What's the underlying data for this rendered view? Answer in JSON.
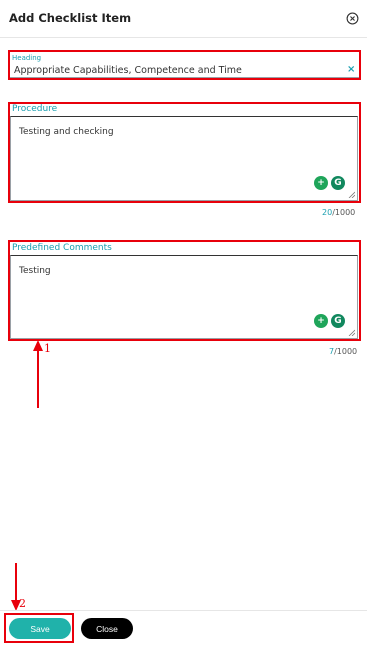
{
  "dialog": {
    "title": "Add Checklist Item"
  },
  "heading": {
    "label": "Heading",
    "value": "Appropriate Capabilities, Competence and Time",
    "clear": "×"
  },
  "procedure": {
    "label": "Procedure",
    "value": "Testing and checking",
    "count": "20",
    "max": "/1000"
  },
  "predefined": {
    "label": "Predefined Comments",
    "value": "Testing",
    "count": "7",
    "max": "/1000"
  },
  "annotations": {
    "one": "1",
    "two": "2"
  },
  "footer": {
    "save_label": "Save",
    "close_label": "Close"
  },
  "colors": {
    "accent": "#1a9fb0",
    "save": "#20b2aa",
    "annotation": "#e8000b"
  },
  "icons": [
    "close-circle-icon",
    "clear-x-icon",
    "add-circle-icon",
    "grammarly-icon",
    "resize-grip-icon",
    "arrow-up-icon",
    "arrow-down-icon"
  ]
}
